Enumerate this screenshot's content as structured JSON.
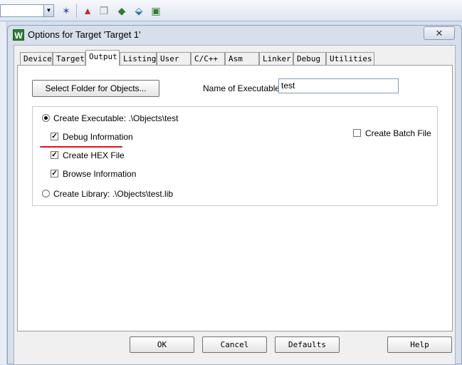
{
  "toolbar": {
    "combo_value": "",
    "icons": [
      "wand-icon",
      "build-icon",
      "window-icon",
      "diamond-icon",
      "download-icon",
      "options-icon"
    ]
  },
  "dialog": {
    "title": "Options for Target 'Target 1'",
    "app_icon_letter": "W",
    "close_glyph": "✕"
  },
  "tabs": [
    {
      "label": "Device"
    },
    {
      "label": "Target"
    },
    {
      "label": "Output",
      "active": true
    },
    {
      "label": "Listing"
    },
    {
      "label": "User"
    },
    {
      "label": "C/C++"
    },
    {
      "label": "Asm"
    },
    {
      "label": "Linker"
    },
    {
      "label": "Debug"
    },
    {
      "label": "Utilities"
    }
  ],
  "output": {
    "select_folder_label": "Select Folder for Objects...",
    "name_exe_label": "Name of Executable:",
    "name_exe_value": "test",
    "create_executable_label": "Create Executable:  .\\Objects\\test",
    "create_executable_selected": true,
    "debug_info_label": "Debug Information",
    "debug_info_checked": true,
    "create_hex_label": "Create HEX File",
    "create_hex_checked": true,
    "browse_info_label": "Browse Information",
    "browse_info_checked": true,
    "create_library_label": "Create Library:  .\\Objects\\test.lib",
    "create_library_selected": false,
    "create_batch_label": "Create Batch File",
    "create_batch_checked": false
  },
  "buttons": {
    "ok": "OK",
    "cancel": "Cancel",
    "defaults": "Defaults",
    "help": "Help"
  },
  "colors": {
    "accent_underline": "#e0141e",
    "title_bar": "#d6dfea"
  }
}
